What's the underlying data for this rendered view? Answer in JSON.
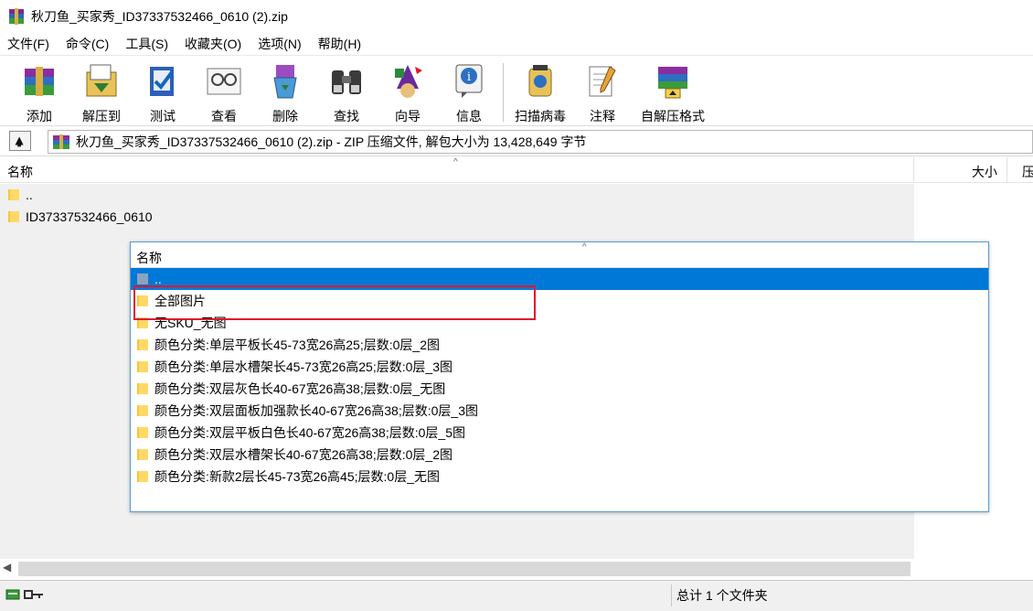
{
  "window": {
    "title": "秋刀鱼_买家秀_ID37337532466_0610 (2).zip"
  },
  "menu": [
    "文件(F)",
    "命令(C)",
    "工具(S)",
    "收藏夹(O)",
    "选项(N)",
    "帮助(H)"
  ],
  "toolbar": [
    {
      "label": "添加",
      "icon": "add-icon"
    },
    {
      "label": "解压到",
      "icon": "extract-to-icon"
    },
    {
      "label": "测试",
      "icon": "test-icon"
    },
    {
      "label": "查看",
      "icon": "view-icon"
    },
    {
      "label": "删除",
      "icon": "delete-icon"
    },
    {
      "label": "查找",
      "icon": "find-icon"
    },
    {
      "label": "向导",
      "icon": "wizard-icon"
    },
    {
      "label": "信息",
      "icon": "info-icon"
    },
    {
      "label": "扫描病毒",
      "icon": "virus-scan-icon"
    },
    {
      "label": "注释",
      "icon": "comment-icon"
    },
    {
      "label": "自解压格式",
      "icon": "sfx-icon"
    }
  ],
  "address": {
    "path": "秋刀鱼_买家秀_ID37337532466_0610 (2).zip - ZIP 压缩文件, 解包大小为 13,428,649 字节"
  },
  "columns": {
    "name": "名称",
    "size": "大小",
    "packed": "压"
  },
  "files": [
    "..",
    "ID37337532466_0610"
  ],
  "popup": {
    "header": "名称",
    "items": [
      "..",
      "全部图片",
      "无SKU_无图",
      "颜色分类:单层平板长45-73宽26高25;层数:0层_2图",
      "颜色分类:单层水槽架长45-73宽26高25;层数:0层_3图",
      "颜色分类:双层灰色长40-67宽26高38;层数:0层_无图",
      "颜色分类:双层面板加强款长40-67宽26高38;层数:0层_3图",
      "颜色分类:双层平板白色长40-67宽26高38;层数:0层_5图",
      "颜色分类:双层水槽架长40-67宽26高38;层数:0层_2图",
      "颜色分类:新款2层长45-73宽26高45;层数:0层_无图"
    ]
  },
  "status": {
    "text": "总计 1 个文件夹"
  },
  "colors": {
    "selection": "#0078d7",
    "highlight": "#e0192a",
    "folder": "#f5c542"
  }
}
